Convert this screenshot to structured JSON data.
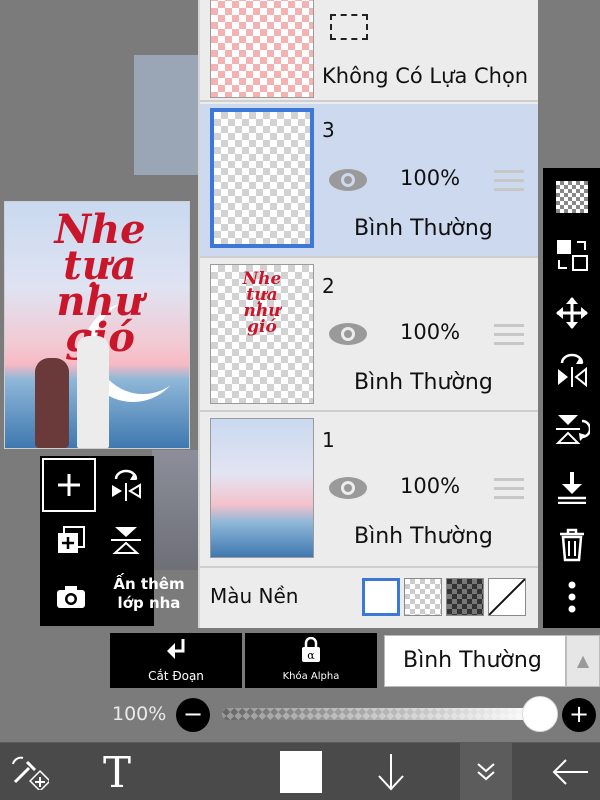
{
  "canvas": {
    "artwork_title": "Nhe tựa như gió",
    "hint_line1": "Ấn thêm",
    "hint_line2": "lớp nha"
  },
  "layers": {
    "selection_layer": {
      "label": "Không Có Lựa Chọn"
    },
    "items": [
      {
        "number": "3",
        "opacity": "100%",
        "blend": "Bình Thường",
        "selected": true
      },
      {
        "number": "2",
        "opacity": "100%",
        "blend": "Bình Thường",
        "selected": false
      },
      {
        "number": "1",
        "opacity": "100%",
        "blend": "Bình Thường",
        "selected": false
      }
    ],
    "background_label": "Màu Nền"
  },
  "bottom_controls": {
    "clipping_label": "Cắt Đoạn",
    "alpha_lock_label": "Khóa Alpha",
    "blend_mode_value": "Bình Thường",
    "opacity_value": "100%",
    "opacity_level": 1.0
  },
  "colors": {
    "selected_layer_bg": "#cdd9ee",
    "selected_border": "#3c78d8",
    "title_red": "#c9162b",
    "toolbar_black": "#000000"
  },
  "icons": {
    "right_toolbar": [
      "checker-icon",
      "swap-icon",
      "move-icon",
      "flip-horizontal-icon",
      "flip-vertical-icon",
      "merge-down-icon",
      "trash-icon",
      "more-icon"
    ],
    "bottom_bar": [
      "transform-icon",
      "text-icon",
      "color-swatch-icon",
      "arrow-down-icon",
      "collapse-icon",
      "back-icon"
    ]
  },
  "bottom_bar": {
    "text_tool_label": "T"
  }
}
